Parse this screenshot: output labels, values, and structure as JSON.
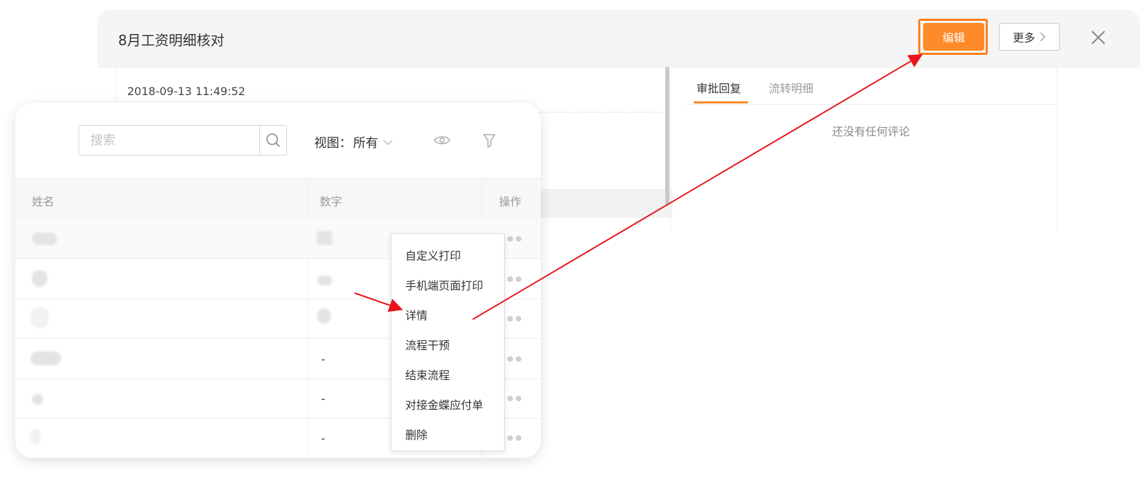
{
  "dialog": {
    "title": "8月工资明细核对",
    "edit_label": "编辑",
    "more_label": "更多",
    "timestamp": "2018-09-13 11:49:52",
    "tabs": [
      {
        "label": "审批回复",
        "active": true
      },
      {
        "label": "流转明细",
        "active": false
      }
    ],
    "empty_comment": "还没有任何评论",
    "accent_color": "#ff8a2a"
  },
  "list": {
    "search": {
      "placeholder": "搜索",
      "value": ""
    },
    "view_label": "视图：",
    "view_value": "所有",
    "columns": {
      "name": "姓名",
      "number": "数字",
      "ops": "操作"
    },
    "rows": [
      {
        "name": "",
        "number": ""
      },
      {
        "name": "",
        "number": ""
      },
      {
        "name": "",
        "number": ""
      },
      {
        "name": "",
        "number": "-"
      },
      {
        "name": "",
        "number": "-"
      },
      {
        "name": "",
        "number": "-"
      }
    ]
  },
  "context_menu": {
    "items": [
      "自定义打印",
      "手机端页面打印",
      "详情",
      "流程干预",
      "结束流程",
      "对接金蝶应付单",
      "删除"
    ]
  },
  "annotation_color": "#e8141c"
}
